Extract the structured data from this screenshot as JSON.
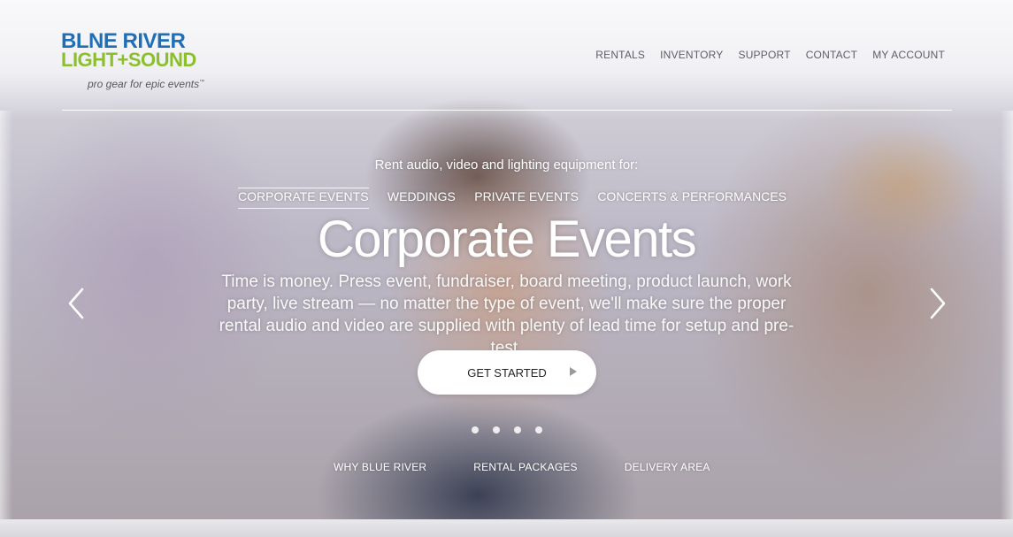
{
  "logo": {
    "line1": "BLNE RIVER",
    "line2": "LIGHT+SOUND",
    "tagline": "pro gear for epic events",
    "trademark": "™",
    "colors": {
      "blue": "#1f6fb6",
      "green": "#8cbf2e"
    }
  },
  "nav": {
    "items": [
      {
        "label": "RENTALS"
      },
      {
        "label": "INVENTORY"
      },
      {
        "label": "SUPPORT"
      },
      {
        "label": "CONTACT"
      },
      {
        "label": "MY ACCOUNT"
      }
    ]
  },
  "hero": {
    "lead": "Rent audio, video and lighting equipment for:",
    "tabs": [
      {
        "label": "CORPORATE EVENTS",
        "active": true
      },
      {
        "label": "WEDDINGS",
        "active": false
      },
      {
        "label": "PRIVATE EVENTS",
        "active": false
      },
      {
        "label": "CONCERTS & PERFORMANCES",
        "active": false
      }
    ],
    "title": "Corporate Events",
    "body": "Time is money. Press event, fundraiser, board meeting, product launch, work party, live stream — no matter the type of event, we'll make sure the proper rental audio and video are supplied with plenty of lead time for setup and pre-test.",
    "cta_label": "GET STARTED",
    "slide_count": 4,
    "prev_icon": "chevron-left-icon",
    "next_icon": "chevron-right-icon"
  },
  "bottom_links": [
    {
      "label": "WHY BLUE RIVER"
    },
    {
      "label": "RENTAL PACKAGES"
    },
    {
      "label": "DELIVERY AREA"
    }
  ]
}
